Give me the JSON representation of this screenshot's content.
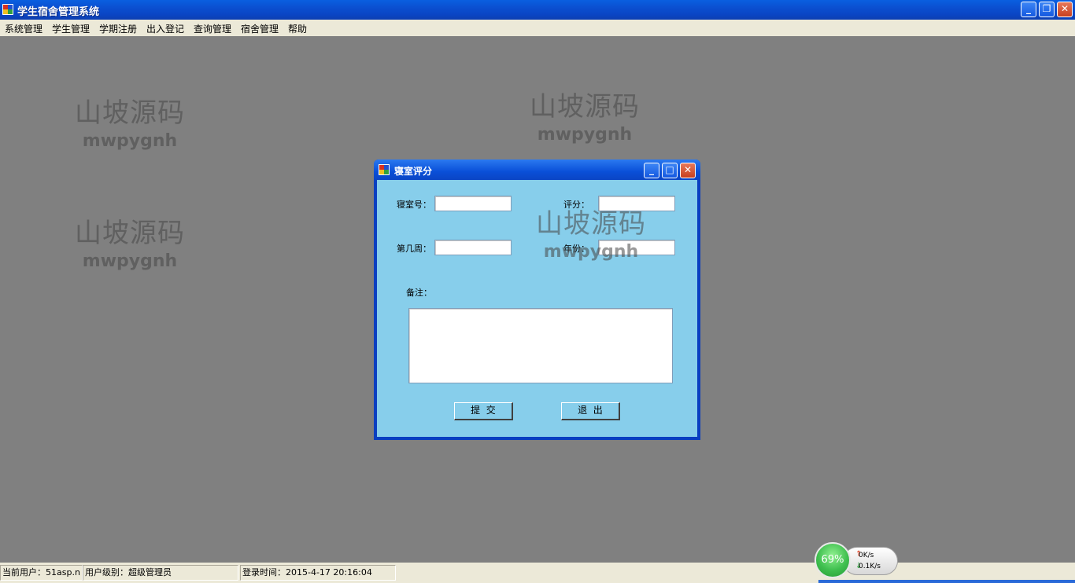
{
  "window": {
    "title": "学生宿舍管理系统",
    "controls": [
      "_",
      "❐",
      "✕"
    ]
  },
  "menu": [
    "系统管理",
    "学生管理",
    "学期注册",
    "出入登记",
    "查询管理",
    "宿舍管理",
    "帮助"
  ],
  "watermark": {
    "cn": "山坡源码",
    "en": "mwpygnh"
  },
  "dialog": {
    "title": "寝室评分",
    "labels": {
      "room": "寝室号：",
      "score": "评分：",
      "week": "第几周：",
      "year": "年份：",
      "remark": "备注："
    },
    "buttons": {
      "submit": "提  交",
      "exit": "退  出"
    },
    "controls": [
      "_",
      "□",
      "✕"
    ]
  },
  "status": {
    "user": "当前用户：51asp.n",
    "level": "用户级别：超级管理员",
    "login_time": "登录时间：2015-4-17 20:16:04"
  },
  "netmon": {
    "percent": "69%",
    "upload": "0K/s",
    "download": "0.1K/s"
  },
  "colors": {
    "dialog_bg": "#87ceeb",
    "workspace": "#808080",
    "title_blue": "#0a4fd8"
  }
}
